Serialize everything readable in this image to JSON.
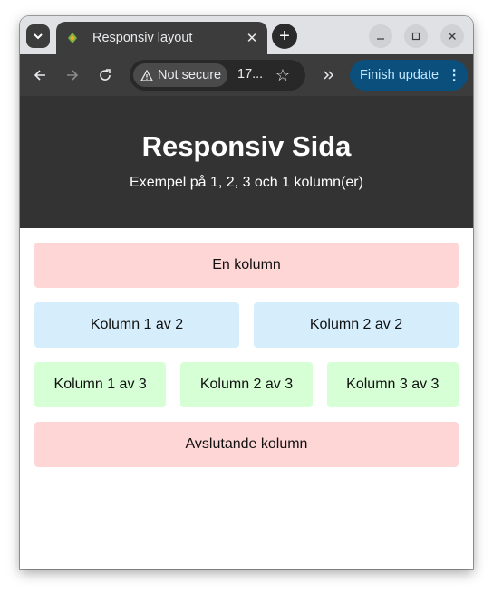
{
  "browser": {
    "tab_title": "Responsiv layout",
    "new_tab_symbol": "+",
    "security_label": "Not secure",
    "url_text": "17...",
    "update_label": "Finish update"
  },
  "page": {
    "heading": "Responsiv Sida",
    "subheading": "Exempel på 1, 2, 3 och 1 kolumn(er)",
    "row1": [
      "En kolumn"
    ],
    "row2": [
      "Kolumn 1 av 2",
      "Kolumn 2 av 2"
    ],
    "row3": [
      "Kolumn 1 av 3",
      "Kolumn 2 av 3",
      "Kolumn 3 av 3"
    ],
    "row4": [
      "Avslutande kolumn"
    ]
  },
  "colors": {
    "header_bg": "#333333",
    "pink": "#ffd6d6",
    "blue": "#d6eefc",
    "green": "#d6ffd6",
    "update_bg": "#0b4f7c"
  },
  "icons": [
    "tab-search-icon",
    "favicon-icon",
    "close-icon",
    "new-tab-icon",
    "minimize-icon",
    "maximize-icon",
    "window-close-icon",
    "back-icon",
    "forward-icon",
    "reload-icon",
    "warning-icon",
    "star-icon",
    "extensions-icon",
    "menu-dots-icon"
  ]
}
